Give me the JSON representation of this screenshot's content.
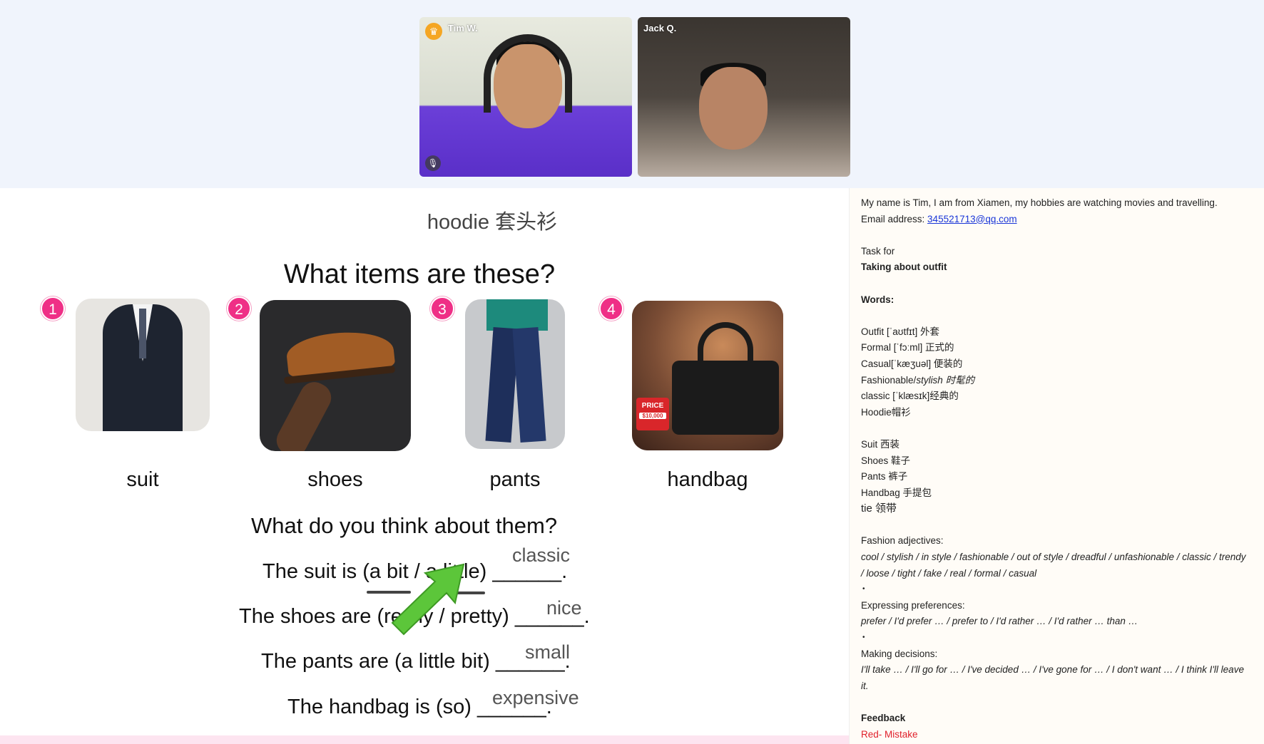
{
  "participants": [
    {
      "name": "Tim W.",
      "host": true,
      "icon": "crown-icon",
      "mic_icon": "microphone-icon"
    },
    {
      "name": "Jack Q.",
      "host": false
    }
  ],
  "slide": {
    "heading_top": "hoodie 套头衫",
    "question1": "What items are these?",
    "items": [
      {
        "number": "1",
        "label": "suit"
      },
      {
        "number": "2",
        "label": "shoes"
      },
      {
        "number": "3",
        "label": "pants"
      },
      {
        "number": "4",
        "label": "handbag"
      }
    ],
    "price_tag": "PRICE",
    "price_value": "$10,000",
    "question2": "What do you think about them?",
    "sentences": [
      {
        "text": "The suit is (a bit / a little) ______.",
        "answer": "classic"
      },
      {
        "text": "The shoes are (really / pretty) ______.",
        "answer": "nice"
      },
      {
        "text": "The pants are (a little bit) ______.",
        "answer": "small"
      },
      {
        "text": "The handbag is (so) ______.",
        "answer": "expensive"
      }
    ]
  },
  "notes": {
    "intro": "My name is Tim, I am from Xiamen, my hobbies are watching movies and travelling.",
    "email_label": "Email address: ",
    "email": "345521713@qq.com",
    "task_for": "Task for",
    "task_title": "Taking about outfit",
    "words_title": "Words:",
    "words1": [
      "Outfit [ˈaʊtfɪt] 外套",
      "Formal  [ˈfɔːml] 正式的",
      "Casual[ˈkæʒuəl] 便装的"
    ],
    "fashionable_a": "Fashionable/",
    "fashionable_b": "stylish 时髦的",
    "words2": [
      "classic [ˈklæsɪk]经典的",
      "Hoodie帽衫"
    ],
    "words3": [
      "Suit 西装",
      "Shoes 鞋子",
      "Pants 裤子",
      "Handbag 手提包"
    ],
    "tie": "tie 领带",
    "adj_title": "Fashion adjectives:",
    "adj_line1": " cool / stylish / in style / fashionable / out of style / dreadful / unfashionable / classic / trendy",
    "adj_line2": "/ loose / tight / fake / real / formal / casual",
    "pref_title": "Expressing preferences:",
    "pref_line": "prefer / I'd prefer … / prefer to / I'd rather … / I'd rather … than …",
    "dec_title": "Making decisions:",
    "dec_line1": "I'll take … / I'll go for … / I've decided … / I've gone for … / I don't want … / I think I'll leave",
    "dec_line2": "it.",
    "feedback_title": "Feedback",
    "feedback_red": "Red- Mistake",
    "bullet": "•"
  },
  "colors": {
    "badge": "#ef2f86",
    "arrow": "#5cc63a",
    "link": "#1a36d8",
    "mistake": "#e0202b"
  }
}
